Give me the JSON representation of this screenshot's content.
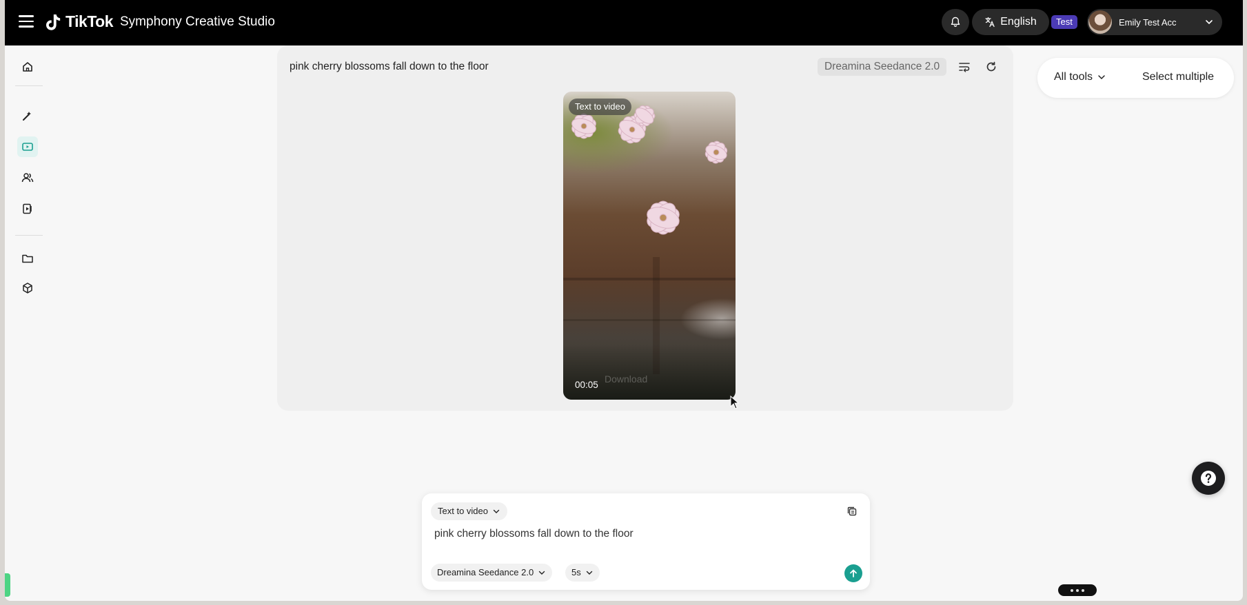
{
  "topbar": {
    "brand_name": "TikTok",
    "product_name": "Symphony Creative Studio",
    "language_label": "English",
    "env_badge": "Test",
    "user_name": "Emily Test Acc"
  },
  "sidebar": {
    "items": [
      {
        "icon": "home-icon"
      },
      {
        "icon": "magic-wand-icon"
      },
      {
        "icon": "video-studio-icon",
        "active": true
      },
      {
        "icon": "avatars-icon"
      },
      {
        "icon": "video-translate-icon"
      },
      {
        "icon": "folder-icon"
      },
      {
        "icon": "cube-icon"
      }
    ]
  },
  "generation": {
    "prompt": "pink cherry blossoms fall down to the floor",
    "model": "Dreamina Seedance 2.0",
    "video": {
      "mode_tag": "Text to video",
      "duration": "00:05",
      "download_label": "Download"
    }
  },
  "tools_panel": {
    "all_tools_label": "All tools",
    "select_multiple_label": "Select multiple"
  },
  "composer": {
    "mode_label": "Text to video",
    "prompt_text": "pink cherry blossoms fall down to the floor",
    "model_label": "Dreamina Seedance 2.0",
    "duration_label": "5s"
  },
  "colors": {
    "accent": "#1a9f90",
    "badge": "#4b3bb5",
    "topbar": "#000000"
  }
}
